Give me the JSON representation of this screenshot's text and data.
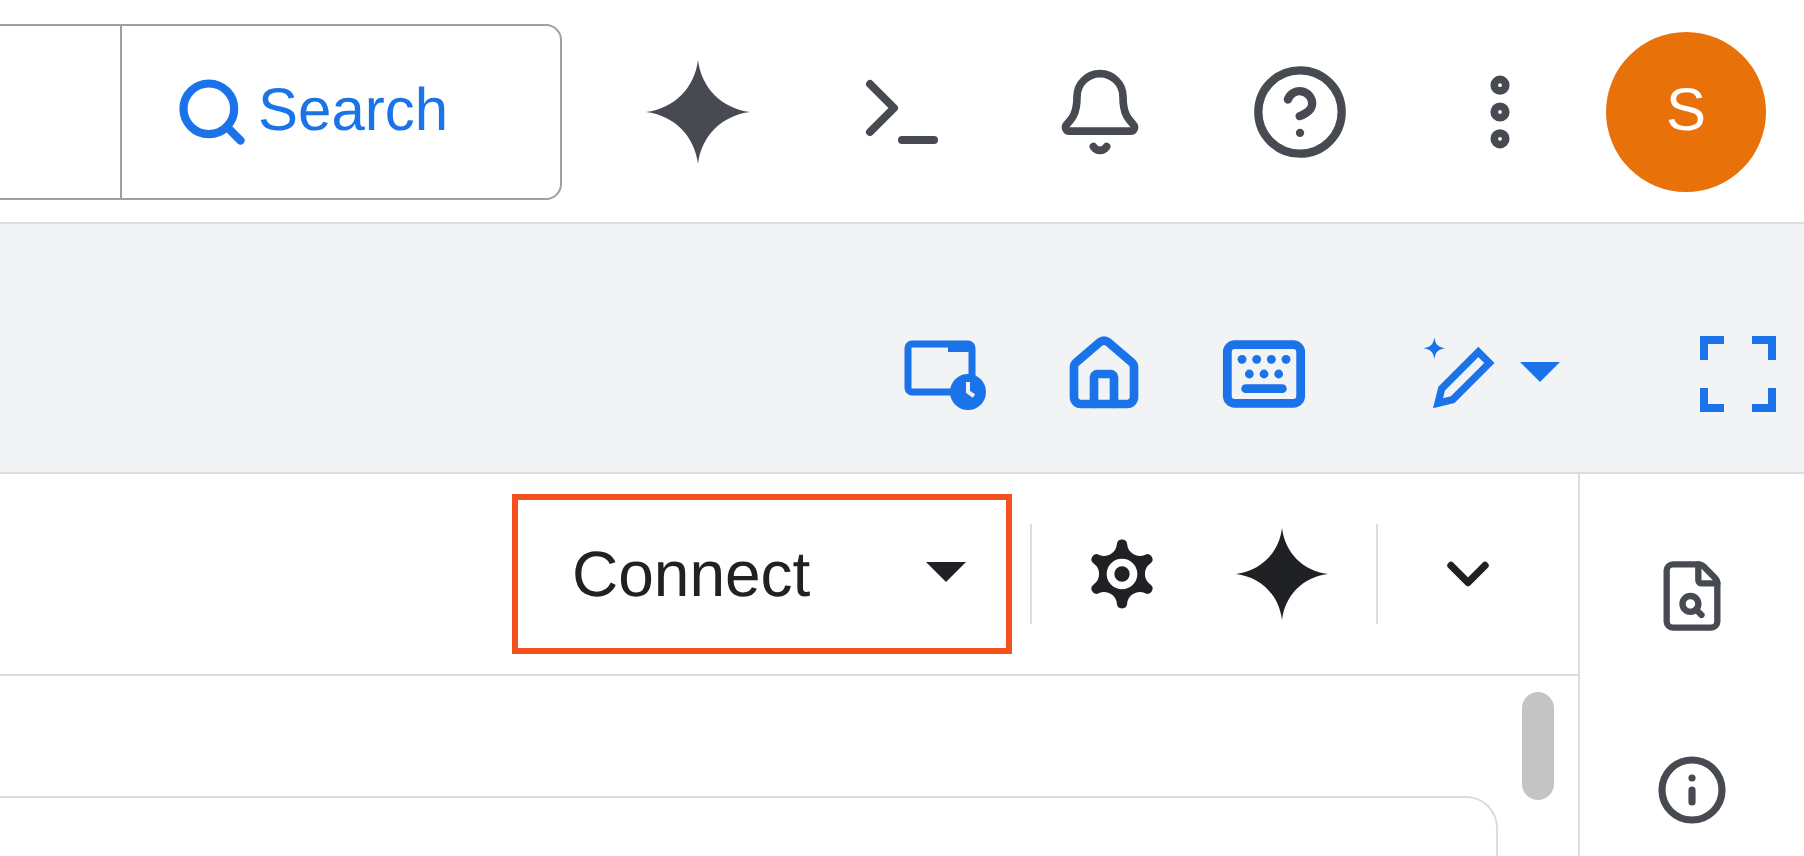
{
  "top_bar": {
    "search_button": {
      "label": "Search"
    },
    "avatar": {
      "initial": "S"
    }
  },
  "toolbar": {
    "connect_button": {
      "label": "Connect",
      "highlighted": true
    }
  }
}
